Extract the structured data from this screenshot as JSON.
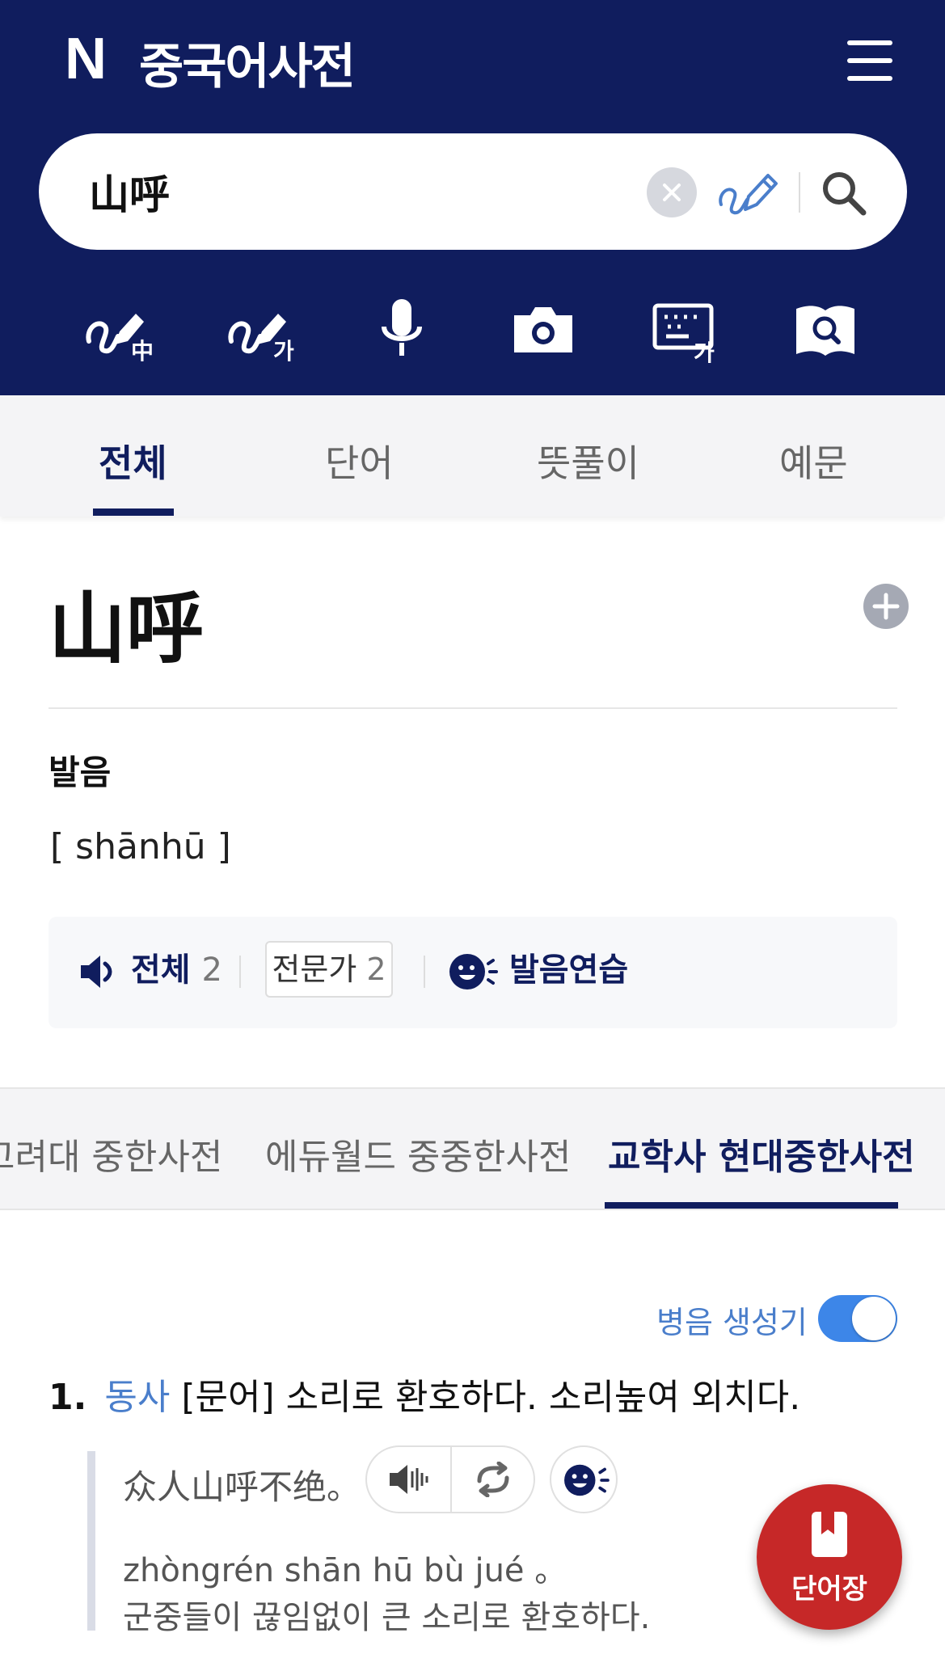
{
  "header": {
    "logo": "N",
    "title": "중국어사전",
    "search_value": "山呼"
  },
  "tabs": [
    {
      "label": "전체",
      "active": true
    },
    {
      "label": "단어",
      "active": false
    },
    {
      "label": "뜻풀이",
      "active": false
    },
    {
      "label": "예문",
      "active": false
    }
  ],
  "entry": {
    "word": "山呼",
    "pronunciation_label": "발음",
    "pinyin": "[ shānhū ]",
    "audio": {
      "all_label": "전체",
      "all_count": "2",
      "expert_label": "전문가",
      "expert_count": "2",
      "practice_label": "발음연습"
    }
  },
  "dict_tabs": [
    {
      "label": "고려대 중한사전",
      "active": false
    },
    {
      "label": "에듀월드 중중한사전",
      "active": false
    },
    {
      "label": "교학사 현대중한사전",
      "active": true
    }
  ],
  "pinyin_generator": {
    "label": "병음 생성기",
    "enabled": true
  },
  "definition": {
    "number": "1.",
    "pos": "동사",
    "text": "[문어] 소리로 환호하다. 소리높여 외치다."
  },
  "example": {
    "chinese": "众人山呼不绝。",
    "pinyin": "zhòngrén shān hū bù jué 。",
    "korean": "군중들이 끊임없이 큰 소리로 환호하다."
  },
  "fab": {
    "label": "단어장"
  },
  "colors": {
    "header_bg": "#101d5e",
    "link_blue": "#4a7ecb",
    "fab_red": "#c62828",
    "toggle_blue": "#3d86e8"
  }
}
